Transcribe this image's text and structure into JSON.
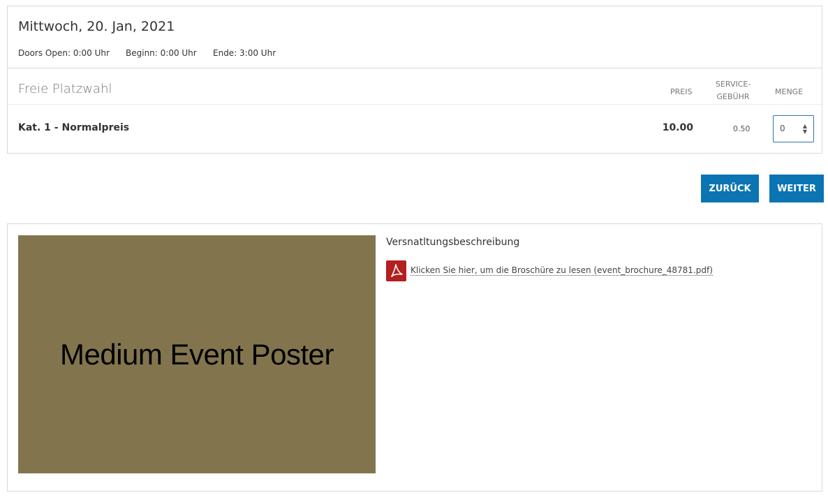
{
  "event": {
    "date": "Mittwoch, 20. Jan, 2021",
    "doors_open": "Doors Open: 0:00 Uhr",
    "begin": "Beginn: 0:00 Uhr",
    "end": "Ende: 3:00 Uhr"
  },
  "tickets": {
    "section_title": "Freie Platzwahl",
    "columns": {
      "price": "PREIS",
      "fee_line1": "SERVICE-",
      "fee_line2": "GEBÜHR",
      "quantity": "MENGE"
    },
    "rows": [
      {
        "category": "Kat. 1 - Normalpreis",
        "price": "10.00",
        "fee": "0.50",
        "quantity": "0"
      }
    ]
  },
  "actions": {
    "back": "ZURÜCK",
    "next": "WEITER"
  },
  "description": {
    "poster_text": "Medium Event Poster",
    "title": "Versnatltungsbeschreibung",
    "brochure_link": "Klicken Sie hier, um die Broschüre zu lesen (event_brochure_48781.pdf)",
    "pdf_icon": "pdf-file-icon"
  },
  "colors": {
    "button": "#0b74b3",
    "poster": "#82754e",
    "pdf_icon": "#b41f1f",
    "select_border": "#2a76ad"
  }
}
